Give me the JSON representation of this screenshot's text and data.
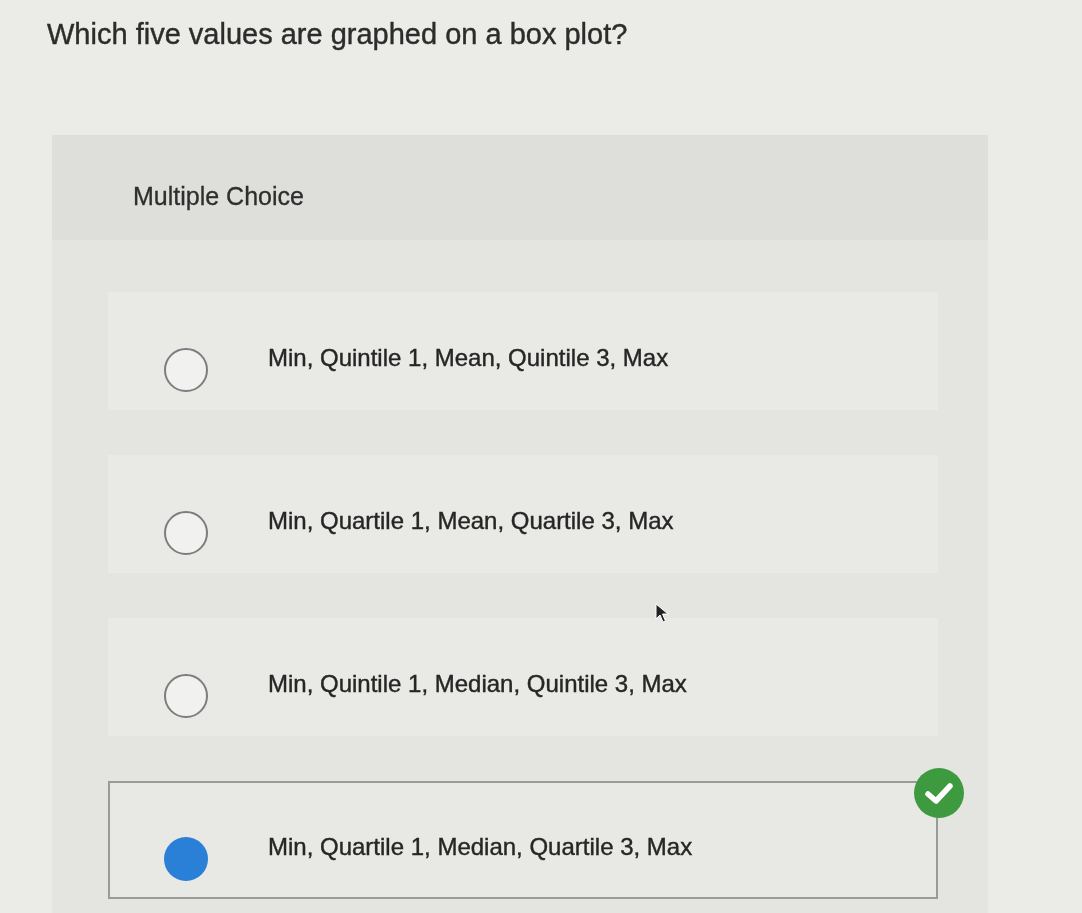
{
  "question": {
    "text": "Which five values are graphed on a box plot?"
  },
  "panel": {
    "label": "Multiple Choice"
  },
  "options": [
    {
      "text": "Min, Quintile 1, Mean, Quintile 3, Max",
      "selected": false,
      "correct": false
    },
    {
      "text": "Min, Quartile 1, Mean, Quartile 3, Max",
      "selected": false,
      "correct": false
    },
    {
      "text": "Min, Quintile 1, Median, Quintile 3, Max",
      "selected": false,
      "correct": false
    },
    {
      "text": "Min, Quartile 1, Median, Quartile 3, Max",
      "selected": true,
      "correct": true
    }
  ]
}
